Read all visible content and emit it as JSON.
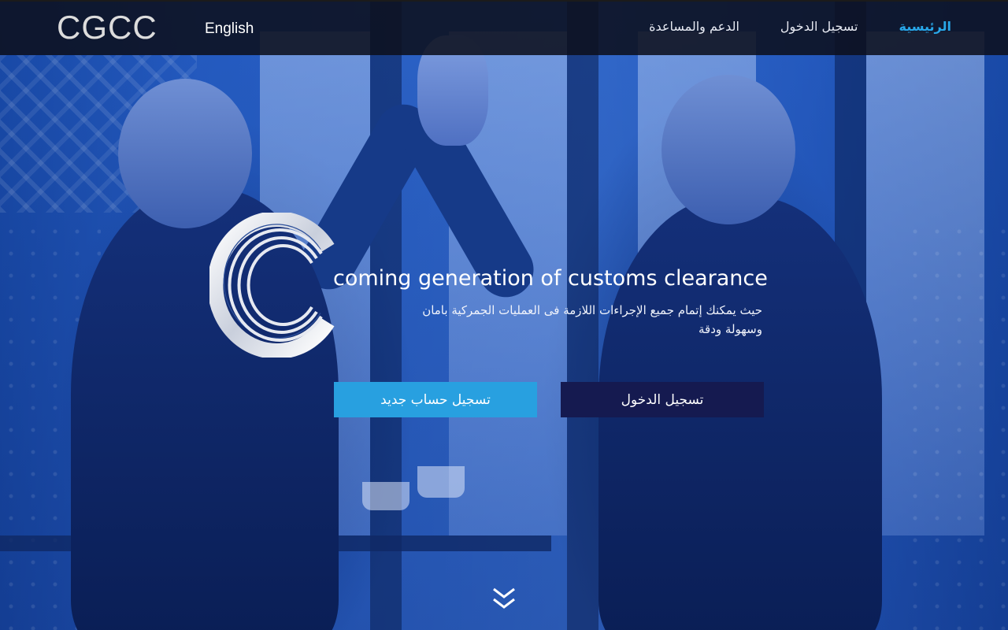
{
  "navbar": {
    "logo_text": "CGCC",
    "language_link": "English",
    "links": [
      {
        "label": "الرئيسية",
        "active": true
      },
      {
        "label": "تسجيل الدخول",
        "active": false
      },
      {
        "label": "الدعم والمساعدة",
        "active": false
      }
    ]
  },
  "hero": {
    "tagline": "coming generation of customs clearance",
    "description": "حيث يمكنك إتمام جميع الإجراءات اللازمة فى العمليات الجمركية بامان وسهولة ودقة",
    "login_button": "تسجيل الدخول",
    "register_button": "تسجيل حساب جديد",
    "scroll_icon": "chevron-double-down-icon"
  },
  "colors": {
    "nav_active": "#28a7e8",
    "register_button": "#28a0e0",
    "login_button": "#151a50"
  }
}
